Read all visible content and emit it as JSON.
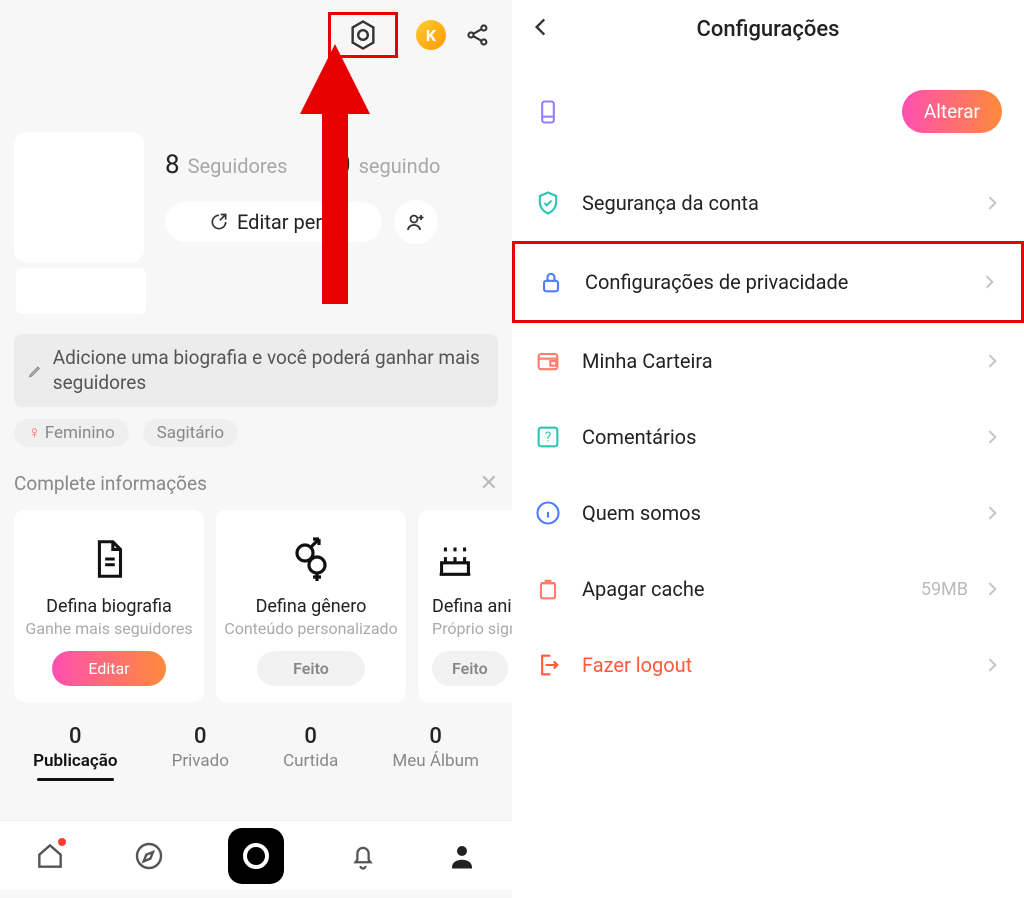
{
  "left": {
    "followers_count": "8",
    "followers_label": "Seguidores",
    "following_count": "10",
    "following_label": "seguindo",
    "edit_profile_label": "Editar perfil",
    "bio_hint": "Adicione uma biografia e você poderá ganhar mais seguidores",
    "tags": {
      "gender": "Feminino",
      "zodiac": "Sagitário"
    },
    "complete_section": {
      "title": "Complete informações",
      "cards": [
        {
          "title": "Defina biografia",
          "subtitle": "Ganhe mais seguidores",
          "button": "Editar"
        },
        {
          "title": "Defina gênero",
          "subtitle": "Conteúdo personalizado",
          "button": "Feito"
        },
        {
          "title": "Defina aniversário",
          "subtitle": "Próprio signo",
          "button": "Feito"
        }
      ]
    },
    "tabs": [
      {
        "count": "0",
        "label": "Publicação"
      },
      {
        "count": "0",
        "label": "Privado"
      },
      {
        "count": "0",
        "label": "Curtida"
      },
      {
        "count": "0",
        "label": "Meu Álbum"
      }
    ]
  },
  "right": {
    "title": "Configurações",
    "alterar_label": "Alterar",
    "items": [
      {
        "label": "Segurança da conta"
      },
      {
        "label": "Configurações de privacidade"
      },
      {
        "label": "Minha Carteira"
      },
      {
        "label": "Comentários"
      },
      {
        "label": "Quem somos"
      },
      {
        "label": "Apagar cache",
        "value": "59MB"
      },
      {
        "label": "Fazer logout"
      }
    ]
  }
}
